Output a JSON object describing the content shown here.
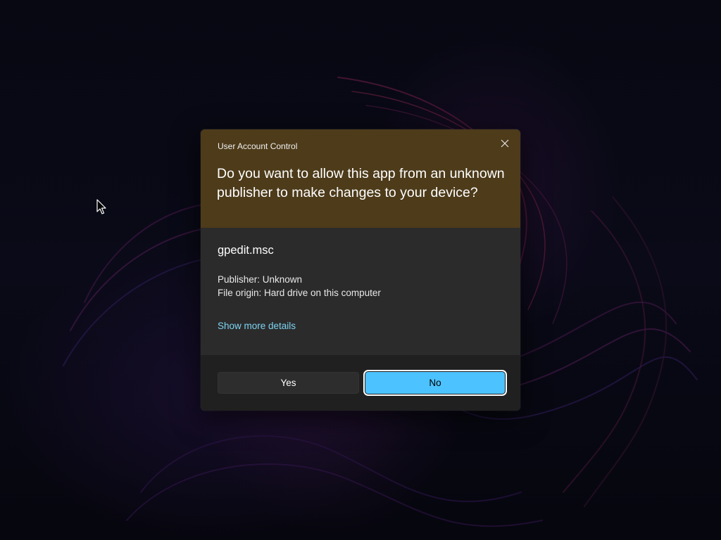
{
  "dialog": {
    "title": "User Account Control",
    "question": "Do you want to allow this app from an unknown publisher to make changes to your device?",
    "app_name": "gpedit.msc",
    "publisher_line": "Publisher: Unknown",
    "origin_line": "File origin: Hard drive on this computer",
    "details_link": "Show more details",
    "buttons": {
      "yes": "Yes",
      "no": "No"
    }
  },
  "colors": {
    "header_background": "#4d3b1a",
    "body_background": "#2b2b2b",
    "footer_background": "#202020",
    "link": "#7ed3f2",
    "primary_button": "#4cc2ff"
  },
  "icons": {
    "close": "close-icon",
    "cursor": "mouse-pointer-icon"
  }
}
